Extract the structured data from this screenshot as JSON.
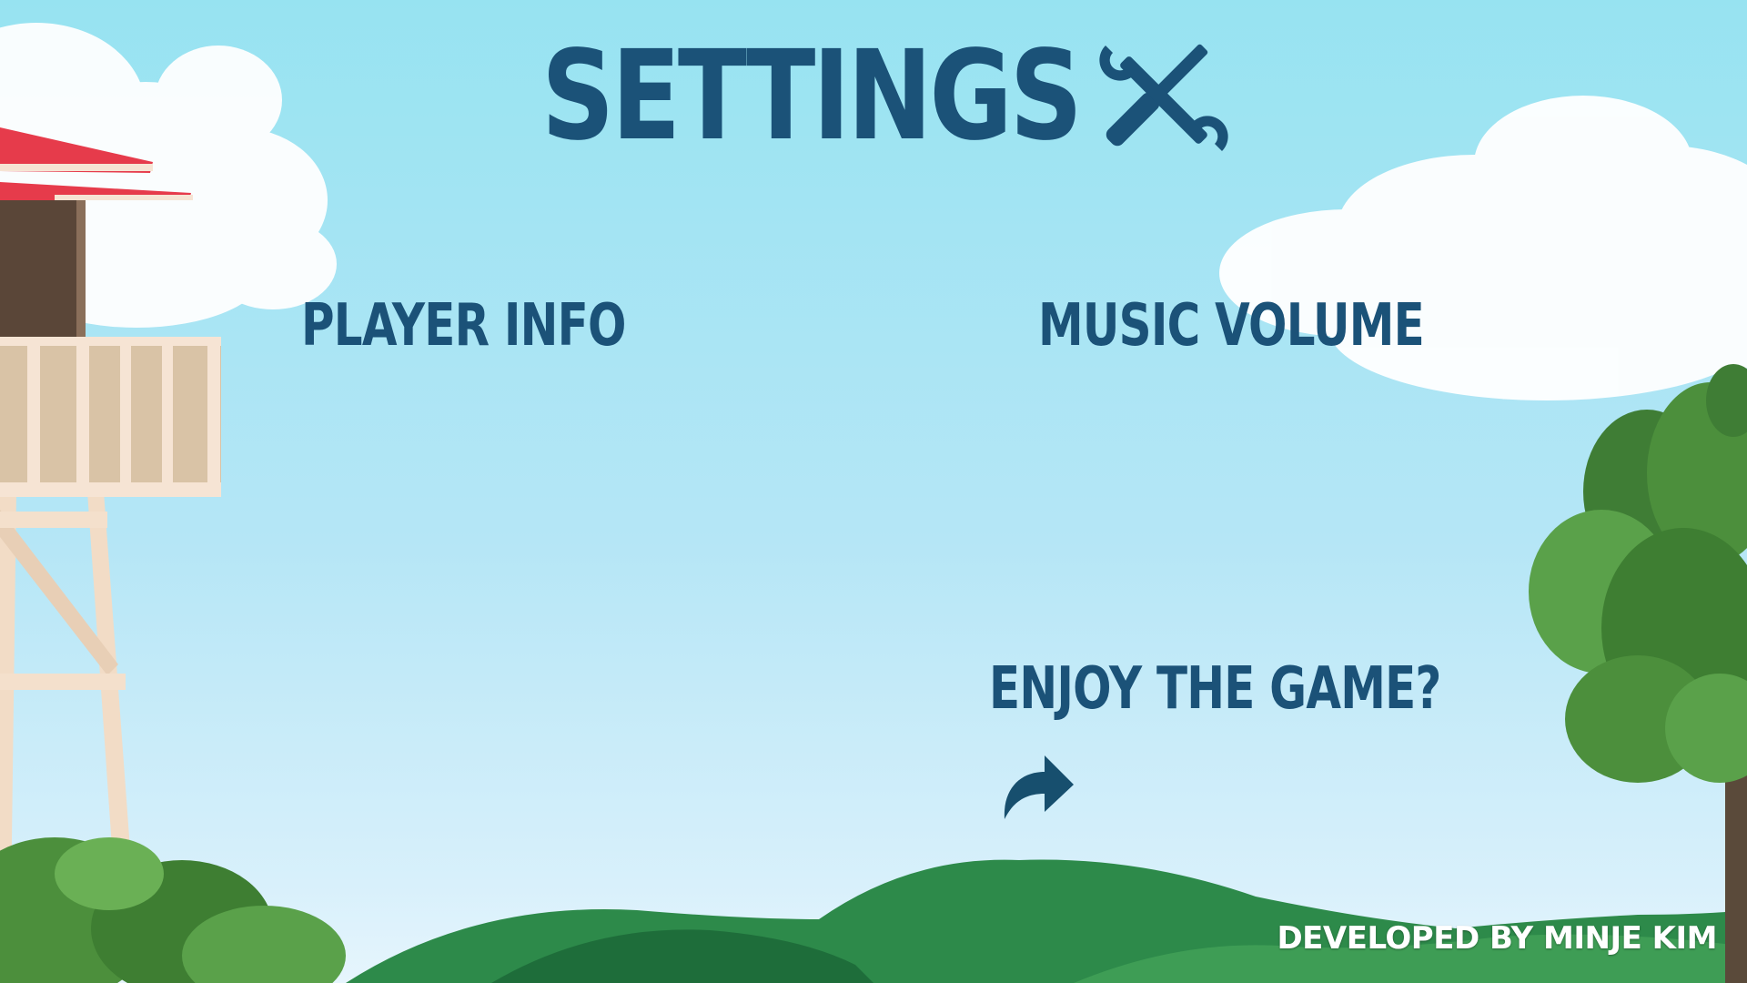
{
  "screen": {
    "title": "SETTINGS",
    "title_icon": "wrench-screwdriver-icon"
  },
  "sections": {
    "player_info": "PLAYER INFO",
    "music_volume": "MUSIC VOLUME",
    "enjoy_prompt": "ENJOY THE GAME?"
  },
  "share": {
    "icon": "share-arrow-icon"
  },
  "footer": {
    "credit": "DEVELOPED BY MINJE KIM"
  },
  "colors": {
    "heading_text": "#1b5278",
    "sky_top": "#97e3f1",
    "sky_bottom": "#e6f5fd",
    "roof": "#e63b4b",
    "hills": "#2d8a4a",
    "credit_text": "#ffffff"
  }
}
